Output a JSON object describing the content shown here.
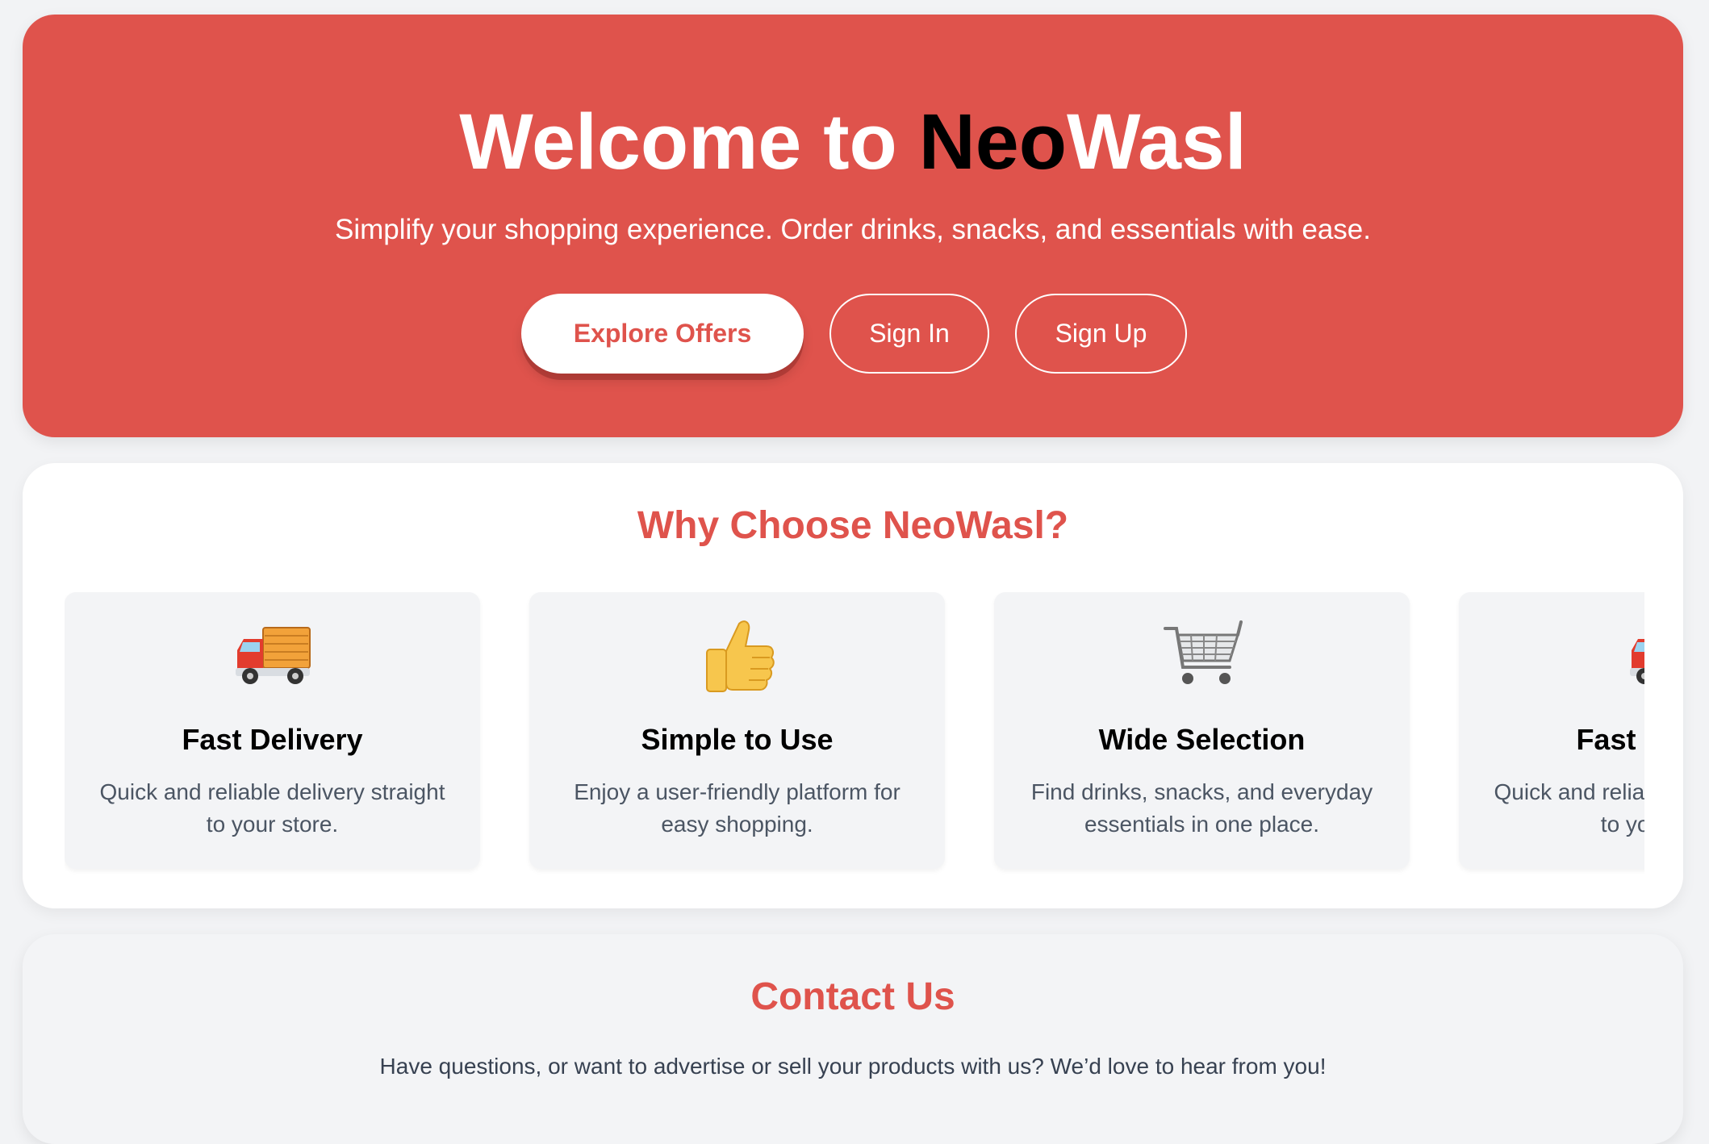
{
  "hero": {
    "title_prefix": "Welcome to ",
    "brand_part1": "Neo",
    "brand_part2": "Wasl",
    "subtitle": "Simplify your shopping experience. Order drinks, snacks, and essentials with ease.",
    "buttons": {
      "explore": "Explore Offers",
      "sign_in": "Sign In",
      "sign_up": "Sign Up"
    }
  },
  "features": {
    "title": "Why Choose NeoWasl?",
    "cards": [
      {
        "icon": "delivery-truck-icon",
        "title": "Fast Delivery",
        "description": "Quick and reliable delivery straight to your store."
      },
      {
        "icon": "thumbs-up-icon",
        "title": "Simple to Use",
        "description": "Enjoy a user-friendly platform for easy shopping."
      },
      {
        "icon": "shopping-cart-icon",
        "title": "Wide Selection",
        "description": "Find drinks, snacks, and everyday essentials in one place."
      },
      {
        "icon": "delivery-truck-icon",
        "title": "Fast Delivery",
        "description": "Quick and reliable delivery straight to your store."
      }
    ]
  },
  "contact": {
    "title": "Contact Us",
    "text": "Have questions, or want to advertise or sell your products with us? We’d love to hear from you!"
  },
  "colors": {
    "accent": "#df534c",
    "background": "#f2f3f5",
    "card": "#f3f4f6"
  }
}
